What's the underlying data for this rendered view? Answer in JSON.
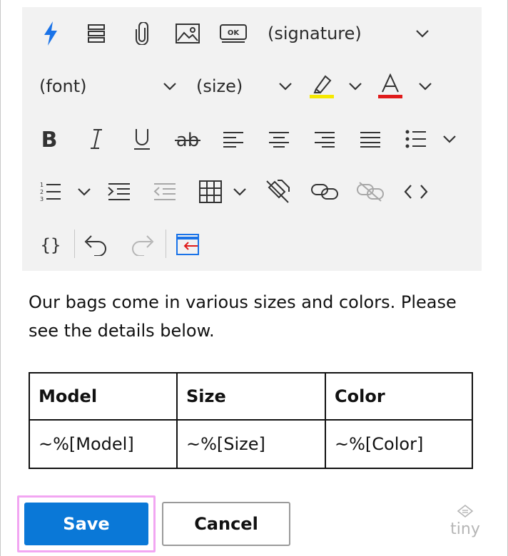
{
  "toolbar": {
    "signature_select": "(signature)",
    "font_select": "(font)",
    "size_select": "(size)",
    "highlight_color": "#f5e800",
    "text_color": "#e01b1b",
    "accent_color": "#1a73e8"
  },
  "content": {
    "paragraph": "Our bags come in various sizes and colors. Please see the details below."
  },
  "table": {
    "headers": [
      "Model",
      "Size",
      "Color"
    ],
    "rows": [
      [
        "~%[Model]",
        "~%[Size]",
        "~%[Color]"
      ]
    ]
  },
  "actions": {
    "save_label": "Save",
    "cancel_label": "Cancel"
  },
  "branding": {
    "logo_text": "tiny"
  }
}
